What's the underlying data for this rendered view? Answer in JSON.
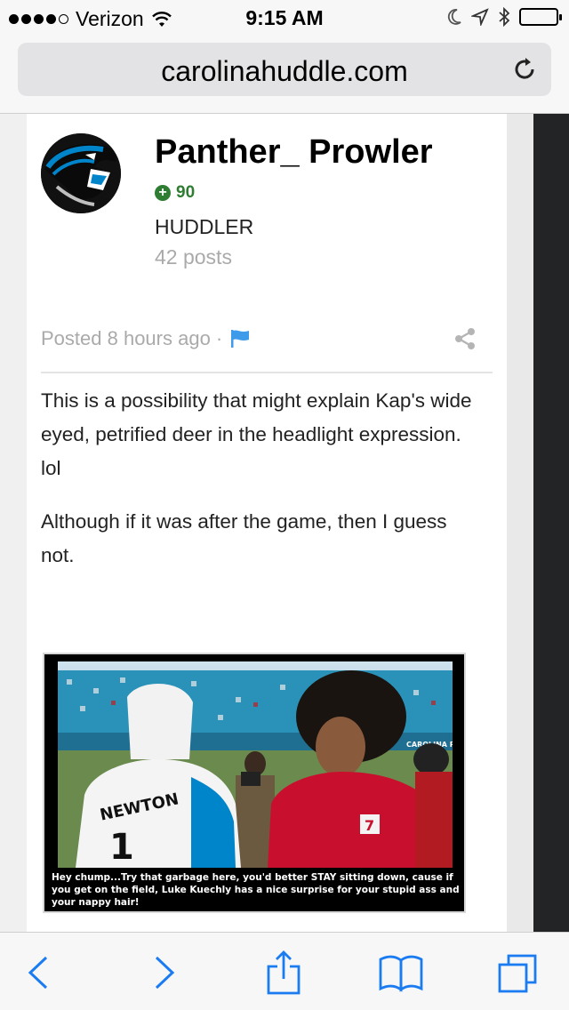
{
  "status": {
    "carrier": "Verizon",
    "time": "9:15 AM"
  },
  "browser": {
    "url": "carolinahuddle.com"
  },
  "profile": {
    "name": "Panther_ Prowler",
    "reputation": "90",
    "rank": "HUDDLER",
    "posts": "42 posts"
  },
  "post": {
    "posted": "Posted 8 hours ago ·",
    "paragraphs": [
      "This is a possibility that might explain Kap's wide eyed, petrified deer in the headlight expression. lol",
      "Although if it was after the game, then I guess not."
    ],
    "image_caption": "Hey chump...Try that garbage here, you'd better STAY sitting down, cause if you get on the field, Luke Kuechly has a nice surprise for your stupid ass and your nappy hair!",
    "image_text": {
      "jersey_name": "NEWTON",
      "jersey_number": "1",
      "red_jersey_number": "7",
      "banner": "CAROLINA PANTHERS"
    }
  },
  "colors": {
    "accent_green": "#2e7d32",
    "ios_blue": "#1b7cf2",
    "flag_blue": "#3d9be9"
  },
  "icons": {
    "wifi": "wifi-icon",
    "moon": "moon-icon",
    "location": "location-arrow-icon",
    "bluetooth": "bluetooth-icon",
    "battery": "battery-icon",
    "reload": "reload-icon",
    "flag": "flag-icon",
    "share": "share-icon",
    "back": "back-icon",
    "forward": "forward-icon",
    "action": "share-action-icon",
    "bookmarks": "bookmarks-icon",
    "tabs": "tabs-icon"
  }
}
